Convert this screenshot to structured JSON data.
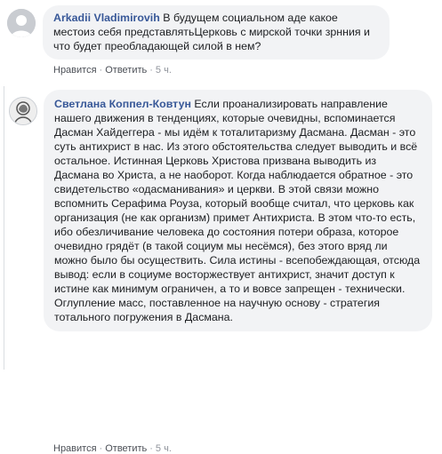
{
  "comments": [
    {
      "author": "Arkadii Vladimirovih",
      "text": "В будущем социальном аде какое местоиз себя представлятьЦерковь с мирской точки зрнния и что будет преобладающей силой в нем?",
      "actions": {
        "like": "Нравится",
        "reply": "Ответить",
        "time": "5 ч."
      }
    },
    {
      "author": "Светлана Коппел-Ковтун",
      "text": "Если проанализировать направление нашего движения в тенденциях, которые очевидны, вспоминается Дасман Хайдеггера - мы идём к тоталитаризму Дасмана. Дасман - это суть антихрист в нас. Из этого обстоятельства следует выводить и всё остальное. Истинная Церковь Христова призвана выводить из Дасмана во Христа, а не наоборот. Когда наблюдается обратное - это свидетельство «одасманивания» и церкви. В этой связи можно вспомнить Серафима Роуза, который вообще считал, что церковь как организация (не как организм) примет Антихриста. В этом что-то есть, ибо обезличивание человека до состояния потери образа, которое очевидно грядёт (в такой социум мы несёмся), без этого вряд ли можно было бы осуществить. Сила истины - всепобеждающая, отсюда вывод: если в социуме восторжествует антихрист, значит доступ к истине как минимум ограничен, а то и вовсе запрещен - технически. Оглупление масс, поставленное на научную основу - стратегия тотального погружения в Дасмана.",
      "actions": {
        "like": "Нравится",
        "reply": "Ответить",
        "time": "5 ч."
      }
    }
  ],
  "colors": {
    "author": "#385898",
    "bubble": "#f2f3f5",
    "meta": "#90949c"
  }
}
